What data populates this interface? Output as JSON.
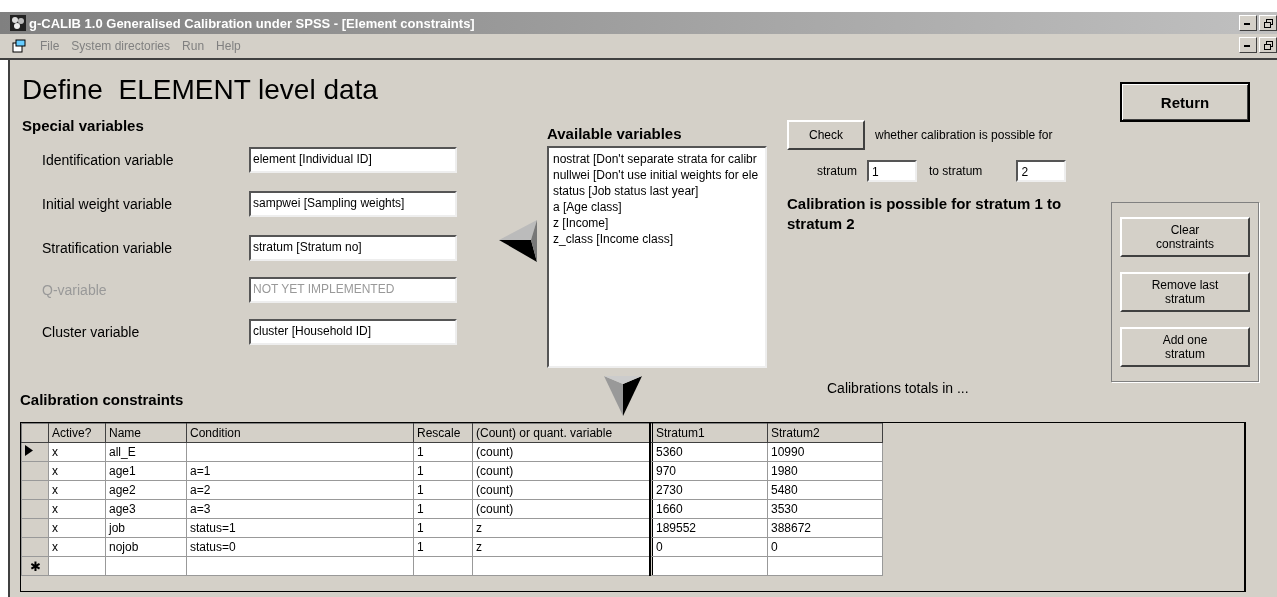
{
  "window": {
    "title": "g-CALIB 1.0 Generalised Calibration under SPSS - [Element constraints]"
  },
  "menu": [
    "File",
    "System directories",
    "Run",
    "Help"
  ],
  "heading": "Define  ELEMENT level data",
  "special_variables": {
    "title": "Special variables",
    "fields": [
      {
        "label": "Identification variable",
        "value": "element [Individual ID]",
        "disabled": false
      },
      {
        "label": "Initial weight variable",
        "value": "sampwei [Sampling weights]",
        "disabled": false
      },
      {
        "label": "Stratification variable",
        "value": "stratum [Stratum no]",
        "disabled": false
      },
      {
        "label": "Q-variable",
        "value": "NOT YET IMPLEMENTED",
        "disabled": true
      },
      {
        "label": "Cluster variable",
        "value": "cluster [Household ID]",
        "disabled": false
      }
    ]
  },
  "available_variables": {
    "title": "Available variables",
    "items": [
      "nostrat [Don't separate strata for calibr",
      "nullwei [Don't use initial weights for ele",
      "status [Job status last year]",
      "a [Age class]",
      "z [Income]",
      "z_class [Income class]"
    ]
  },
  "check": {
    "button": "Check",
    "text": "whether calibration is possible for",
    "from_label": "stratum",
    "from_value": "1",
    "to_label": "to stratum",
    "to_value": "2",
    "message": "Calibration is possible for stratum 1 to stratum 2"
  },
  "return_button": "Return",
  "side_buttons": [
    "Clear constraints",
    "Remove last stratum",
    "Add one stratum"
  ],
  "constraints": {
    "title": "Calibration constraints",
    "totals_caption": "Calibrations totals in ...",
    "columns": [
      "Active?",
      "Name",
      "Condition",
      "Rescale",
      "(Count) or quant. variable"
    ],
    "total_columns": [
      "Stratum1",
      "Stratum2"
    ],
    "new_row_marker": "✱",
    "rows": [
      {
        "selected": true,
        "cells": [
          "x",
          "all_E",
          "",
          "1",
          "(count)"
        ],
        "totals": [
          "5360",
          "10990"
        ]
      },
      {
        "selected": false,
        "cells": [
          "x",
          "age1",
          "a=1",
          "1",
          "(count)"
        ],
        "totals": [
          "970",
          "1980"
        ]
      },
      {
        "selected": false,
        "cells": [
          "x",
          "age2",
          "a=2",
          "1",
          "(count)"
        ],
        "totals": [
          "2730",
          "5480"
        ]
      },
      {
        "selected": false,
        "cells": [
          "x",
          "age3",
          "a=3",
          "1",
          "(count)"
        ],
        "totals": [
          "1660",
          "3530"
        ]
      },
      {
        "selected": false,
        "cells": [
          "x",
          "job",
          "status=1",
          "1",
          "z"
        ],
        "totals": [
          "189552",
          "388672"
        ]
      },
      {
        "selected": false,
        "cells": [
          "x",
          "nojob",
          "status=0",
          "1",
          "z"
        ],
        "totals": [
          "0",
          "0"
        ]
      }
    ]
  }
}
